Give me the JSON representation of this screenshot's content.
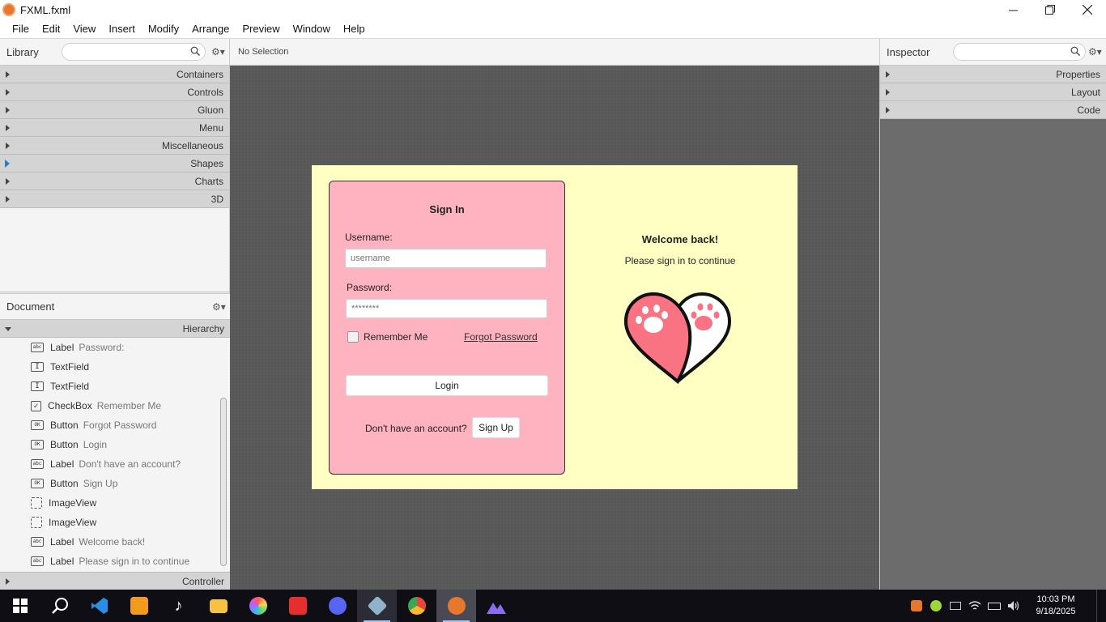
{
  "window": {
    "title": "FXML.fxml"
  },
  "menu": [
    "File",
    "Edit",
    "View",
    "Insert",
    "Modify",
    "Arrange",
    "Preview",
    "Window",
    "Help"
  ],
  "library": {
    "title": "Library",
    "sections": [
      "Containers",
      "Controls",
      "Gluon",
      "Menu",
      "Miscellaneous",
      "Shapes",
      "Charts",
      "3D"
    ]
  },
  "document": {
    "title": "Document",
    "hierarchy_label": "Hierarchy",
    "controller_label": "Controller",
    "tree": [
      {
        "icon": "abc",
        "type": "Label",
        "value": "Password:"
      },
      {
        "icon": "I",
        "type": "TextField",
        "value": ""
      },
      {
        "icon": "I",
        "type": "TextField",
        "value": ""
      },
      {
        "icon": "✓",
        "type": "CheckBox",
        "value": "Remember Me"
      },
      {
        "icon": "OK",
        "type": "Button",
        "value": "Forgot Password"
      },
      {
        "icon": "OK",
        "type": "Button",
        "value": "Login"
      },
      {
        "icon": "abc",
        "type": "Label",
        "value": "Don't have an account?"
      },
      {
        "icon": "OK",
        "type": "Button",
        "value": "Sign Up"
      },
      {
        "icon": "",
        "type": "ImageView",
        "value": ""
      },
      {
        "icon": "",
        "type": "ImageView",
        "value": ""
      },
      {
        "icon": "abc",
        "type": "Label",
        "value": "Welcome back!"
      },
      {
        "icon": "abc",
        "type": "Label",
        "value": "Please sign in to continue"
      }
    ]
  },
  "selection": {
    "text": "No Selection"
  },
  "form": {
    "title": "Sign In",
    "username_label": "Username:",
    "username_placeholder": "username",
    "password_label": "Password:",
    "password_placeholder": "********",
    "remember_label": "Remember Me",
    "forgot_label": "Forgot Password",
    "login_label": "Login",
    "no_account_label": "Don't have an account?",
    "signup_label": "Sign Up",
    "welcome": "Welcome back!",
    "subtitle": "Please sign in to continue"
  },
  "inspector": {
    "title": "Inspector",
    "sections": [
      "Properties",
      "Layout",
      "Code"
    ]
  },
  "taskbar": {
    "time": "10:03 PM",
    "date": "9/18/2025"
  },
  "colors": {
    "canvas_bg": "#ffffc4",
    "card_bg": "#ffb3c0",
    "heart_pink": "#fa7382"
  }
}
